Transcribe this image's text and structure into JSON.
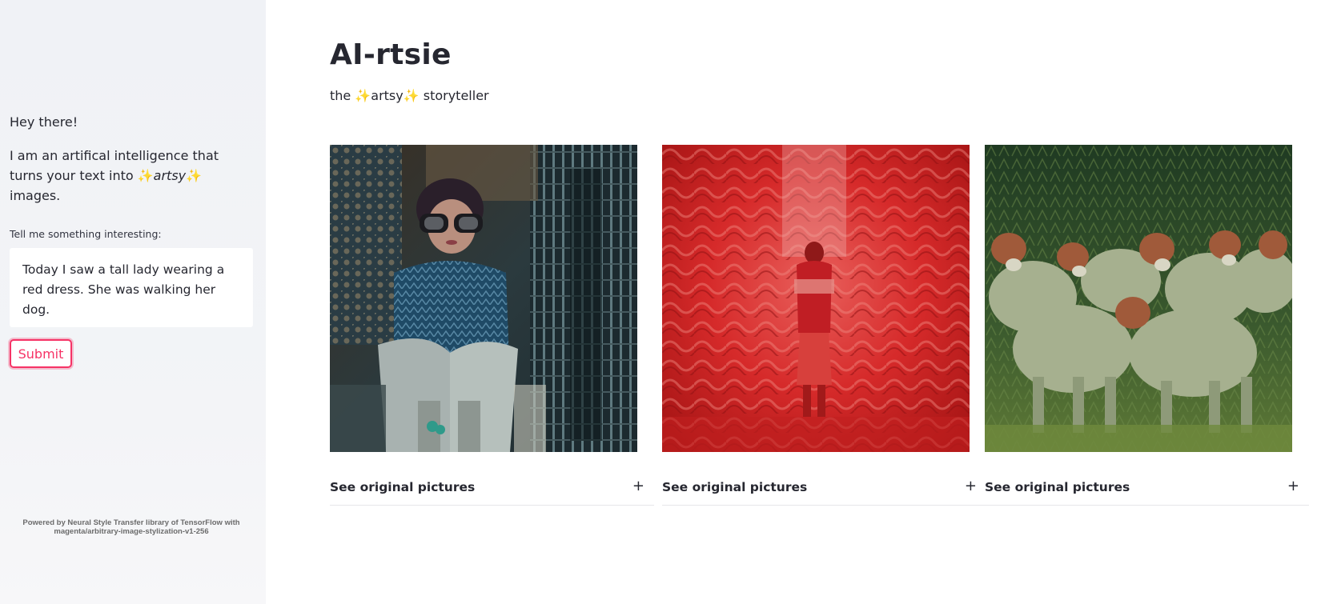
{
  "sidebar": {
    "greeting": "Hey there!",
    "intro_before": "I am an artifical intelligence that turns your text into ",
    "intro_sparkle_left": "✨",
    "intro_emph": "artsy",
    "intro_sparkle_right": "✨",
    "intro_after": " images.",
    "input_label": "Tell me something interesting:",
    "input_value": "Today I saw a tall lady wearing a red dress. She was walking her dog.",
    "submit_label": "Submit",
    "footer": "Powered by Neural Style Transfer library of TensorFlow with magenta/arbitrary-image-stylization-v1-256"
  },
  "main": {
    "title": "AI-rtsie",
    "subtitle": "the ✨artsy✨ storyteller",
    "cards": [
      {
        "expander_label": "See original pictures",
        "expander_icon": "+"
      },
      {
        "expander_label": "See original pictures",
        "expander_icon": "+"
      },
      {
        "expander_label": "See original pictures",
        "expander_icon": "+"
      }
    ]
  },
  "colors": {
    "accent": "#f63366",
    "sidebar_bg": "#f0f2f6",
    "text": "#262730"
  }
}
